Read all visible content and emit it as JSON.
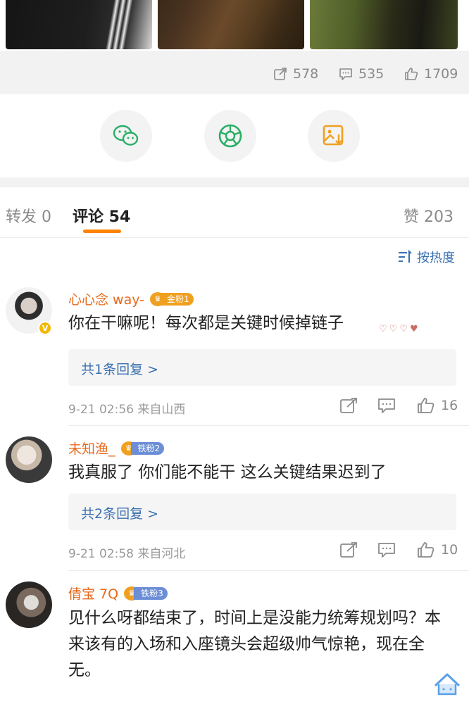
{
  "post": {
    "stats": {
      "reposts": "578",
      "comments": "535",
      "likes": "1709"
    },
    "share_targets": [
      {
        "icon": "wechat-icon"
      },
      {
        "icon": "moments-icon"
      },
      {
        "icon": "save-image-icon"
      }
    ]
  },
  "tabs": {
    "repost": "转发 0",
    "comments": "评论 54",
    "likes": "赞 203"
  },
  "sort": {
    "label": "按热度"
  },
  "comments": [
    {
      "username": "心心念 way-",
      "fan_level": "金粉1",
      "fan_crown": "8",
      "text": "你在干嘛呢！每次都是关键时候掉链子",
      "reply_count_label": "共1条回复 >",
      "meta": "9-21 02:56  来自山西",
      "like_count": "16",
      "verified": true
    },
    {
      "username": "未知渔_",
      "fan_level": "铁粉2",
      "fan_crown": "",
      "text": "我真服了 你们能不能干 这么关键结果迟到了",
      "reply_count_label": "共2条回复 >",
      "meta": "9-21 02:58  来自河北",
      "like_count": "10",
      "verified": false
    },
    {
      "username": "倩宝 7Q",
      "fan_level": "铁粉3",
      "fan_crown": "",
      "text": "见什么呀都结束了，时间上是没能力统筹规划吗？本来该有的入场和入座镜头会超级帅气惊艳，现在全无。",
      "verified": false
    }
  ],
  "colors": {
    "accent_orange": "#ff8200",
    "username_orange": "#e8681a",
    "link_blue": "#3a6fb0",
    "gold_badge": "#f0a020",
    "iron_badge": "#6b8ed6"
  }
}
